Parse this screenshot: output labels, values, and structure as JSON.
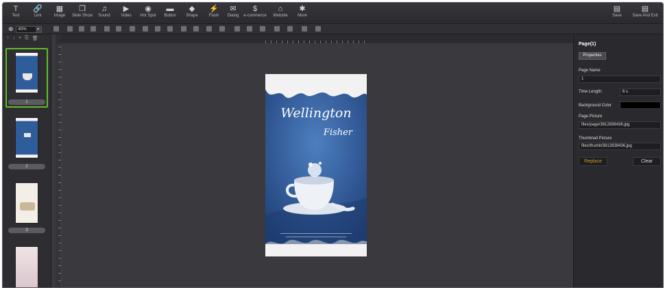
{
  "toolbar": {
    "items": [
      {
        "label": "Text",
        "icon": "T"
      },
      {
        "label": "Link",
        "icon": "🔗"
      },
      {
        "label": "Image",
        "icon": "▦"
      },
      {
        "label": "Slide Show",
        "icon": "❐"
      },
      {
        "label": "Sound",
        "icon": "♫"
      },
      {
        "label": "Video",
        "icon": "▶"
      },
      {
        "label": "Hot Spot",
        "icon": "◉"
      },
      {
        "label": "Button",
        "icon": "▬"
      },
      {
        "label": "Shape",
        "icon": "◆"
      },
      {
        "label": "Flash",
        "icon": "⚡"
      },
      {
        "label": "Dialog",
        "icon": "✉"
      },
      {
        "label": "e-commerce",
        "icon": "$"
      },
      {
        "label": "Website",
        "icon": "⌂"
      },
      {
        "label": "More",
        "icon": "✱"
      }
    ],
    "save_label": "Save",
    "save_exit_label": "Save And Exit"
  },
  "zoom": {
    "value": "40%"
  },
  "pages": {
    "tools": [
      "↑",
      "↓",
      "+",
      "⎘",
      "🗑"
    ],
    "items": [
      {
        "label": "1"
      },
      {
        "label": "2"
      },
      {
        "label": "3"
      }
    ]
  },
  "page_content": {
    "title_line1": "Wellington",
    "title_line2": "Fisher"
  },
  "props": {
    "title": "Page(1)",
    "tab": "Properties",
    "page_name_label": "Page Name",
    "page_name_value": "1",
    "time_length_label": "Time Length:",
    "time_length_value": "6 s",
    "bg_color_label": "Background Color",
    "bg_color": "#000000",
    "page_picture_label": "Page Picture",
    "page_picture_value": "files/page/3812838436.jpg",
    "thumb_picture_label": "Thumbnail Picture",
    "thumb_picture_value": "files/thumb/3812838436.jpg",
    "replace_label": "Replace",
    "clear_label": "Clear"
  },
  "colors": {
    "accent": "#d79a2a",
    "selection": "#5fbf2a",
    "page_blue": "#2f5c9a"
  }
}
